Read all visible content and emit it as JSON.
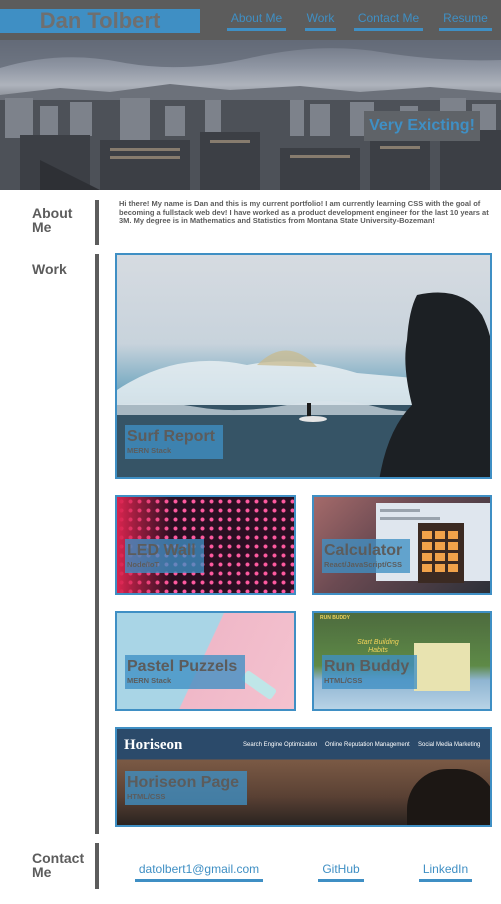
{
  "header": {
    "brand": "Dan Tolbert",
    "nav": [
      "About Me",
      "Work",
      "Contact Me",
      "Resume"
    ]
  },
  "hero": {
    "badge": "Very Exicting!"
  },
  "about": {
    "label": "About Me",
    "text": "Hi there! My name is Dan and this is my current portfolio! I am currently learning CSS with the goal of becoming a fullstack web dev! I have worked as a product development engineer for the last 10 years at 3M. My degree is in Mathematics and Statistics from Montana State University-Bozeman!"
  },
  "work": {
    "label": "Work",
    "projects": [
      {
        "title": "Surf Report",
        "stack": "MERN Stack"
      },
      {
        "title": "LED Wall",
        "stack": "Node/IoT"
      },
      {
        "title": "Calculator",
        "stack": "React/JavaScript/CSS"
      },
      {
        "title": "Pastel Puzzels",
        "stack": "MERN Stack"
      },
      {
        "title": "Run Buddy",
        "stack": "HTML/CSS"
      },
      {
        "title": "Horiseon Page",
        "stack": "HTML/CSS"
      }
    ],
    "screens": {
      "runbuddy_brand": "RUN BUDDY",
      "runbuddy_headline": "Start Building Habits",
      "horiseon_brand": "Horiseon",
      "horiseon_nav": [
        "Search Engine Optimization",
        "Online Reputation Management",
        "Social Media Marketing"
      ]
    }
  },
  "contact": {
    "label": "Contact Me",
    "links": [
      "datolbert1@gmail.com",
      "GitHub",
      "LinkedIn"
    ]
  },
  "colors": {
    "accent": "#3f8fc4",
    "dark": "#5c5c5c"
  }
}
